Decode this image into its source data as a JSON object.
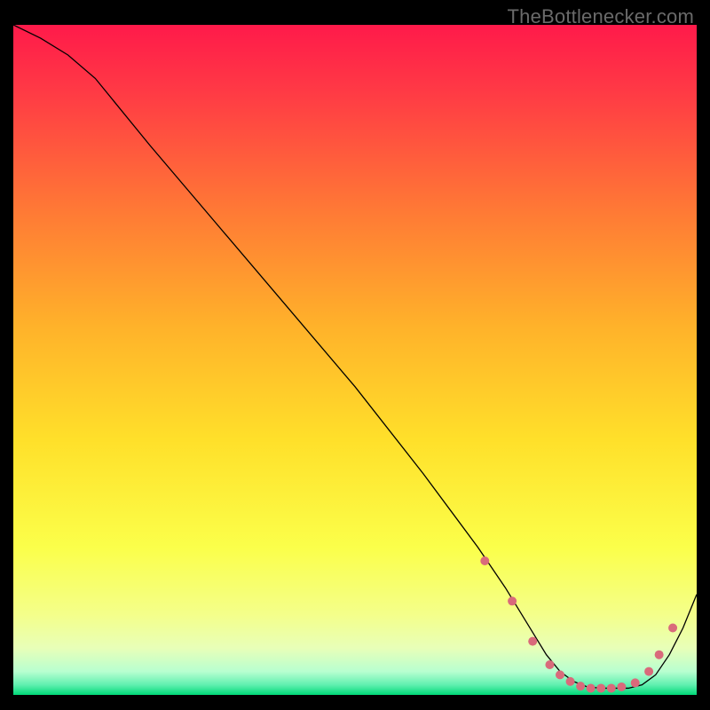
{
  "watermark": "TheBottlenecker.com",
  "chart_data": {
    "type": "line",
    "title": "",
    "xlabel": "",
    "ylabel": "",
    "xlim": [
      0,
      100
    ],
    "ylim": [
      0,
      100
    ],
    "background_gradient": {
      "top": "#ff1a4a",
      "mid_upper": "#ff8a2a",
      "mid": "#ffe02a",
      "mid_lower": "#f4ff5a",
      "near_bottom": "#d8ffb0",
      "bottom": "#00e07a"
    },
    "series": [
      {
        "name": "bottleneck-curve",
        "color": "#000000",
        "stroke_width": 1.3,
        "x": [
          0,
          4,
          8,
          12,
          20,
          30,
          40,
          50,
          60,
          68,
          72,
          75,
          78,
          80,
          82,
          84,
          86,
          88,
          90,
          92,
          94,
          96,
          98,
          100
        ],
        "values": [
          100,
          98,
          95.5,
          92,
          82,
          70,
          58,
          46,
          33,
          22,
          16,
          11,
          6,
          3.5,
          2,
          1.2,
          1,
          1,
          1,
          1.5,
          3,
          6,
          10,
          15
        ]
      }
    ],
    "markers": {
      "name": "optimal-range",
      "color": "#d96a7b",
      "radius": 5,
      "points": [
        {
          "x": 69,
          "y": 20
        },
        {
          "x": 73,
          "y": 14
        },
        {
          "x": 76,
          "y": 8
        },
        {
          "x": 78.5,
          "y": 4.5
        },
        {
          "x": 80,
          "y": 3
        },
        {
          "x": 81.5,
          "y": 2
        },
        {
          "x": 83,
          "y": 1.3
        },
        {
          "x": 84.5,
          "y": 1
        },
        {
          "x": 86,
          "y": 1
        },
        {
          "x": 87.5,
          "y": 1
        },
        {
          "x": 89,
          "y": 1.2
        },
        {
          "x": 91,
          "y": 1.8
        },
        {
          "x": 93,
          "y": 3.5
        },
        {
          "x": 94.5,
          "y": 6
        },
        {
          "x": 96.5,
          "y": 10
        }
      ]
    }
  }
}
